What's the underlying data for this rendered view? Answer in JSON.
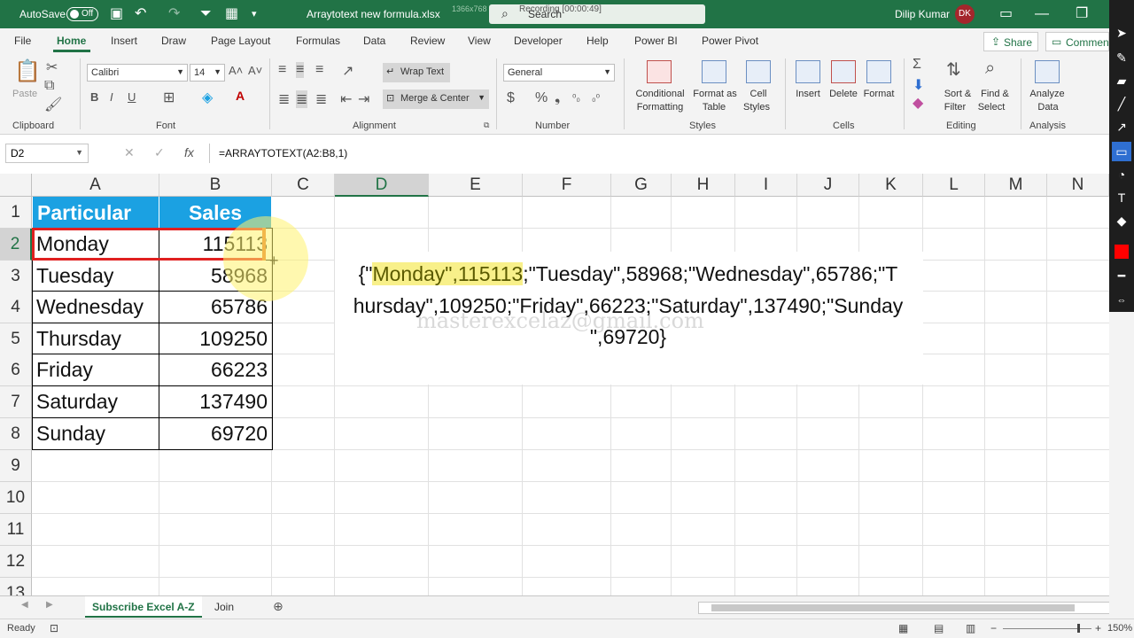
{
  "titlebar": {
    "autosave_label": "AutoSave",
    "autosave_state": "Off",
    "file_name": "Arraytotext new formula.xlsx",
    "dims": "1366x768",
    "search_label": "Search",
    "recording_label": "Recording [00:00:49]",
    "user_name": "Dilip Kumar",
    "user_initials": "DK"
  },
  "tabs": [
    "File",
    "Home",
    "Insert",
    "Draw",
    "Page Layout",
    "Formulas",
    "Data",
    "Review",
    "View",
    "Developer",
    "Help",
    "Power BI",
    "Power Pivot"
  ],
  "share_label": "Share",
  "comments_label": "Comments",
  "ribbon": {
    "clipboard": {
      "paste": "Paste",
      "label": "Clipboard"
    },
    "font": {
      "name": "Calibri",
      "size": "14",
      "label": "Font"
    },
    "alignment": {
      "wrap": "Wrap Text",
      "merge": "Merge & Center",
      "label": "Alignment"
    },
    "number": {
      "format": "General",
      "label": "Number"
    },
    "styles": {
      "cond1": "Conditional",
      "cond2": "Formatting",
      "fmt1": "Format as",
      "fmt2": "Table",
      "cell1": "Cell",
      "cell2": "Styles",
      "label": "Styles"
    },
    "cells": {
      "insert": "Insert",
      "delete": "Delete",
      "format": "Format",
      "label": "Cells"
    },
    "editing": {
      "sort1": "Sort &",
      "sort2": "Filter",
      "find1": "Find &",
      "find2": "Select",
      "label": "Editing"
    },
    "analysis": {
      "a1": "Analyze",
      "a2": "Data",
      "label": "Analysis"
    }
  },
  "formula_bar": {
    "name_box": "D2",
    "formula": "=ARRAYTOTEXT(A2:B8,1)"
  },
  "columns": [
    "A",
    "B",
    "C",
    "D",
    "E",
    "F",
    "G",
    "H",
    "I",
    "J",
    "K",
    "L",
    "M",
    "N"
  ],
  "rows": [
    "1",
    "2",
    "3",
    "4",
    "5",
    "6",
    "7",
    "8",
    "9",
    "10",
    "11",
    "12",
    "13"
  ],
  "table": {
    "header": [
      "Particular",
      "Sales"
    ],
    "rows": [
      [
        "Monday",
        "115113"
      ],
      [
        "Tuesday",
        "58968"
      ],
      [
        "Wednesday",
        "65786"
      ],
      [
        "Thursday",
        "109250"
      ],
      [
        "Friday",
        "66223"
      ],
      [
        "Saturday",
        "137490"
      ],
      [
        "Sunday",
        "69720"
      ]
    ]
  },
  "result": {
    "open": "{\"",
    "highlight": "Monday\",115113",
    "line1_rest": ";\"Tuesday\",58968;\"Wednesday\",65786;\"T",
    "line2": "hursday\",109250;\"Friday\",66223;\"Saturday\",137490;\"Sunday",
    "line3": "\",69720}"
  },
  "watermark": "masterexcelaz@gmail.com",
  "sheets": [
    "Subscribe Excel A-Z",
    "Join"
  ],
  "status": {
    "ready": "Ready",
    "zoom": "150%"
  },
  "colors": {
    "accent": "#217346",
    "header_fill": "#1ba1e2",
    "selection": "#e02020"
  }
}
